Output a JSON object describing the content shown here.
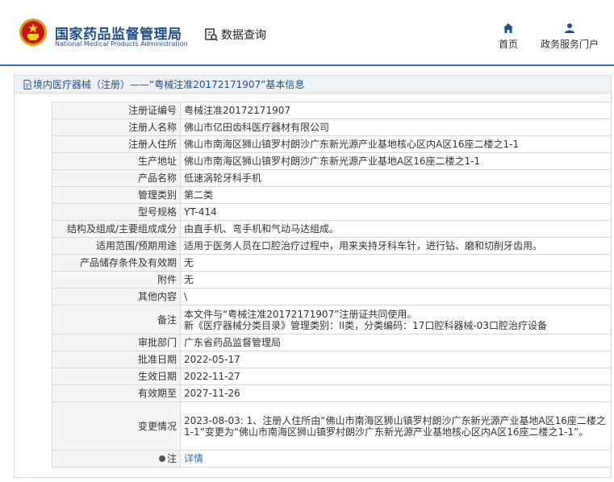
{
  "header": {
    "agency_cn": "国家药品监督管理局",
    "agency_en": "National Medical Products Administration",
    "query_label": "数据查询",
    "nav": [
      {
        "label": "首页",
        "icon": "home-icon"
      },
      {
        "label": "政务服务门户",
        "icon": "user-icon"
      }
    ],
    "accent_color": "#2e6fbf"
  },
  "panel": {
    "title": "境内医疗器械（注册）——“粤械注准20172171907”基本信息"
  },
  "rows": [
    {
      "label": "注册证编号",
      "value": "粤械注准20172171907"
    },
    {
      "label": "注册人名称",
      "value": "佛山市亿田齿科医疗器材有限公司"
    },
    {
      "label": "注册人住所",
      "value": "佛山市南海区狮山镇罗村朗沙广东新光源产业基地核心区内A区16座二楼之1-1"
    },
    {
      "label": "生产地址",
      "value": "佛山市南海区狮山镇罗村朗沙广东新光源产业基地A区16座二楼之1-1"
    },
    {
      "label": "产品名称",
      "value": "低速涡轮牙科手机"
    },
    {
      "label": "管理类别",
      "value": "第二类"
    },
    {
      "label": "型号规格",
      "value": "YT-414"
    },
    {
      "label": "结构及组成/主要组成成分",
      "value": "由直手机、弯手机和气动马达组成。"
    },
    {
      "label": "适用范围/预期用途",
      "value": "适用于医务人员在口腔治疗过程中，用来夹持牙科车针，进行钻、磨和切削牙齿用。"
    },
    {
      "label": "产品储存条件及有效期",
      "value": "无"
    },
    {
      "label": "附件",
      "value": "无"
    },
    {
      "label": "其他内容",
      "value": "\\"
    },
    {
      "label": "备注",
      "value_line1": "本文件与“粤械注准20172171907”注册证共同使用。",
      "value_line2": "新《医疗器械分类目录》管理类别：II类，分类编码：17口腔科器械-03口腔治疗设备"
    },
    {
      "label": "审批部门",
      "value": "广东省药品监督管理局"
    },
    {
      "label": "批准日期",
      "value": "2022-05-17"
    },
    {
      "label": "生效日期",
      "value": "2022-11-27"
    },
    {
      "label": "有效期至",
      "value": "2027-11-26"
    },
    {
      "label": "变更情况",
      "value": "2023-08-03: 1、注册人住所由“佛山市南海区狮山镇罗村朗沙广东新光源产业基地A区16座二楼之1-1”变更为“佛山市南海区狮山镇罗村朗沙广东新光源产业基地核心区内A区16座二楼之1-1”。"
    },
    {
      "label": "注",
      "value": "详情"
    }
  ]
}
